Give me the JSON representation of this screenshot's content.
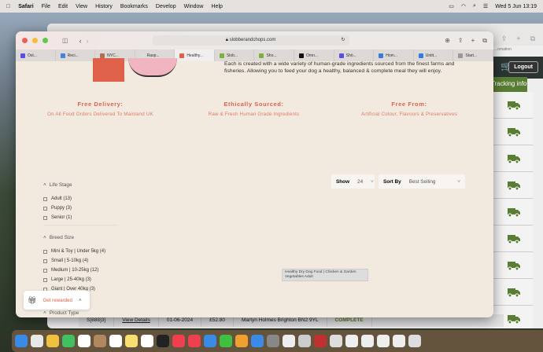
{
  "menubar": {
    "app": "Safari",
    "items": [
      "File",
      "Edit",
      "View",
      "History",
      "Bookmarks",
      "Develop",
      "Window",
      "Help"
    ],
    "clock": "Wed 5 Jun  13:19"
  },
  "browser": {
    "url": "slobberandchops.com",
    "tabs": [
      {
        "label": "Ost...",
        "color": "#5b4fe0"
      },
      {
        "label": "Reci...",
        "color": "#4a7fe0"
      },
      {
        "label": "NYC...",
        "color": "#b07050"
      },
      {
        "label": "Rasp...",
        "color": "#ddd"
      },
      {
        "label": "Healthy...",
        "color": "#e0614a",
        "active": true
      },
      {
        "label": "Slob...",
        "color": "#7ab040"
      },
      {
        "label": "Sho...",
        "color": "#7ab040"
      },
      {
        "label": "Omn...",
        "color": "#111"
      },
      {
        "label": "Shö...",
        "color": "#5b4fe0"
      },
      {
        "label": "Hom...",
        "color": "#3a7ae0"
      },
      {
        "label": "Untit...",
        "color": "#3a7ae0"
      },
      {
        "label": "Start...",
        "color": "#999"
      }
    ]
  },
  "page": {
    "intro": "Each is created with a wide variety of human-grade ingredients sourced from the finest farms and fisheries. Allowing you to feed your dog a healthy, balanced & complete meal they will enjoy.",
    "features": [
      {
        "title": "Free Delivery:",
        "text": "On All Food Orders Delivered To Mainland UK"
      },
      {
        "title": "Ethically Sourced:",
        "text": "Raw & Fresh Human Grade Ingredients"
      },
      {
        "title": "Free From:",
        "text": "Artificial Colour, Flavours & Preservatives"
      }
    ],
    "filters": {
      "life_stage": {
        "title": "Life Stage",
        "options": [
          "Adult (13)",
          "Puppy (3)",
          "Senior (1)"
        ]
      },
      "breed_size": {
        "title": "Breed Size",
        "options": [
          "Mini & Toy | Under 5kg (4)",
          "Small | 5-10kg (4)",
          "Medium | 10-25kg (12)",
          "Large | 25-40kg (3)",
          "Giant | Over 40kg (3)"
        ]
      },
      "product_type": {
        "title": "Product Type"
      }
    },
    "show": {
      "label": "Show",
      "value": "24"
    },
    "sort": {
      "label": "Sort By",
      "value": "Best Selling"
    },
    "tooltip": "Healthy Dry Dog Food | Chicken & Garden Vegetables Adult",
    "reward": "Get rewarded"
  },
  "backwindow": {
    "tab": "...omation",
    "logout": "Logout",
    "tracking": "Tracking info",
    "row": [
      "S[888]3]",
      "View Details",
      "01-06-2024",
      "£52.80",
      "Martyn Holmes Brighton BN2 9YL",
      "COMPLETE"
    ],
    "accent": "#5a7d34"
  }
}
